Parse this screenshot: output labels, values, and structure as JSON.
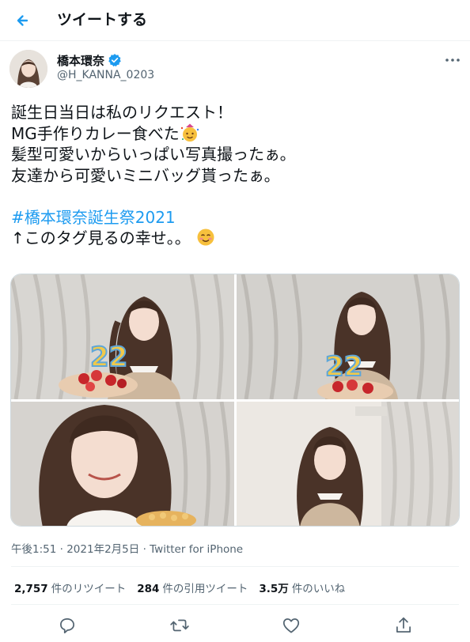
{
  "header": {
    "title": "ツイートする",
    "back_icon": "arrow-left-icon",
    "accent": "#1d9bf0"
  },
  "author": {
    "name": "橋本環奈",
    "handle": "@H_KANNA_0203",
    "verified": true
  },
  "tweet": {
    "lines": [
      "誕生日当日は私のリクエスト！",
      "MG手作りカレー食べた",
      "髪型可愛いからいっぱい写真撮ったぁ。",
      "友達から可愛いミニバッグ貰ったぁ。",
      "",
      "#橋本環奈誕生祭2021",
      "↑このタグ見るの幸せ。。"
    ]
  },
  "meta": {
    "time": "午後1:51",
    "separator": "·",
    "date": "2021年2月5日",
    "source": "Twitter for iPhone"
  },
  "stats": [
    {
      "num": "2,757",
      "label": "件のリツイート"
    },
    {
      "num": "284",
      "label": "件の引用ツイート"
    },
    {
      "num": "3.5万",
      "label": "件のいいね"
    }
  ],
  "actions": [
    "reply-icon",
    "retweet-icon",
    "like-icon",
    "share-icon"
  ],
  "cake_label": "22"
}
